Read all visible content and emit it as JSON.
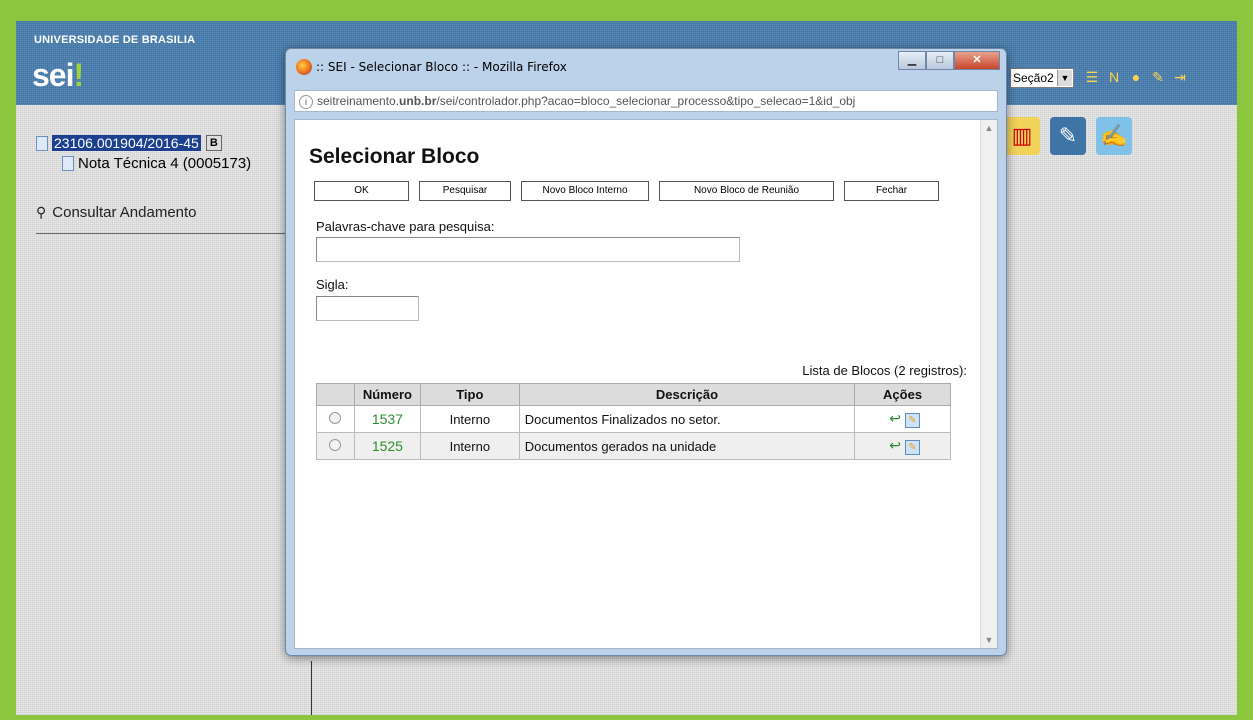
{
  "app": {
    "university": "UNIVERSIDADE DE BRASILIA",
    "logo": "sei",
    "logo_mark": "!",
    "unit_select": "Seção2"
  },
  "tree": {
    "process_number": "23106.001904/2016-45",
    "badge": "B",
    "document": "Nota Técnica 4 (0005173)",
    "consult": "Consultar Andamento"
  },
  "popup": {
    "window_title": ":: SEI - Selecionar Bloco :: - Mozilla Firefox",
    "url_prefix": "seitreinamento.",
    "url_bold": "unb.br",
    "url_rest": "/sei/controlador.php?acao=bloco_selecionar_processo&tipo_selecao=1&id_obj",
    "page_title": "Selecionar Bloco",
    "buttons": {
      "ok": "OK",
      "pesquisar": "Pesquisar",
      "novo_interno": "Novo Bloco Interno",
      "novo_reuniao": "Novo Bloco de Reunião",
      "fechar": "Fechar"
    },
    "keywords_label": "Palavras-chave para pesquisa:",
    "keywords_value": "",
    "sigla_label": "Sigla:",
    "sigla_value": "",
    "list_caption": "Lista de Blocos (2 registros):",
    "table": {
      "headers": [
        "",
        "Número",
        "Tipo",
        "Descrição",
        "Ações"
      ],
      "rows": [
        {
          "numero": "1537",
          "tipo": "Interno",
          "descricao": "Documentos Finalizados no setor."
        },
        {
          "numero": "1525",
          "tipo": "Interno",
          "descricao": "Documentos gerados na unidade"
        }
      ]
    }
  },
  "colors": {
    "page_border": "#8cc63f",
    "header_blue": "#3f74a6",
    "number_green": "#2f8c2f"
  }
}
